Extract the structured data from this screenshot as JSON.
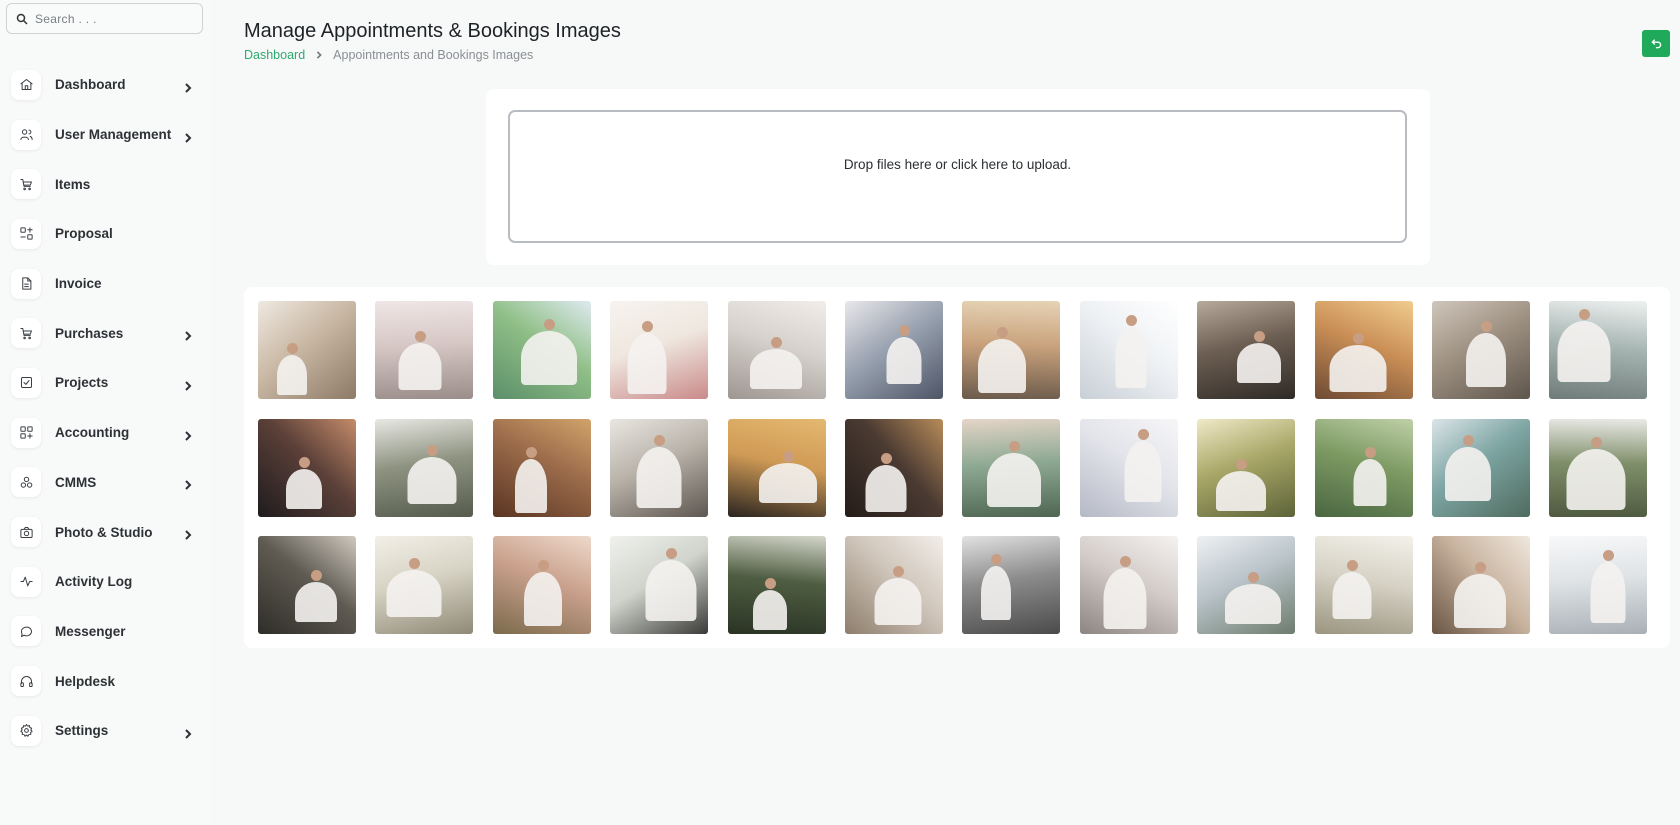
{
  "search": {
    "placeholder": "Search . . ."
  },
  "sidebar": {
    "items": [
      {
        "name": "dashboard",
        "label": "Dashboard",
        "icon": "home-icon",
        "chevron": true
      },
      {
        "name": "user-management",
        "label": "User Management",
        "icon": "users-icon",
        "chevron": true
      },
      {
        "name": "items",
        "label": "Items",
        "icon": "cart-icon",
        "chevron": false
      },
      {
        "name": "proposal",
        "label": "Proposal",
        "icon": "proposal-icon",
        "chevron": false
      },
      {
        "name": "invoice",
        "label": "Invoice",
        "icon": "file-icon",
        "chevron": false
      },
      {
        "name": "purchases",
        "label": "Purchases",
        "icon": "cart-icon",
        "chevron": true
      },
      {
        "name": "projects",
        "label": "Projects",
        "icon": "check-square-icon",
        "chevron": true
      },
      {
        "name": "accounting",
        "label": "Accounting",
        "icon": "grid-icon",
        "chevron": true
      },
      {
        "name": "cmms",
        "label": "CMMS",
        "icon": "cmms-icon",
        "chevron": true
      },
      {
        "name": "photo-studio",
        "label": "Photo & Studio",
        "icon": "camera-icon",
        "chevron": true
      },
      {
        "name": "activity-log",
        "label": "Activity Log",
        "icon": "activity-icon",
        "chevron": false
      },
      {
        "name": "messenger",
        "label": "Messenger",
        "icon": "chat-icon",
        "chevron": false
      },
      {
        "name": "helpdesk",
        "label": "Helpdesk",
        "icon": "headphones-icon",
        "chevron": false
      },
      {
        "name": "settings",
        "label": "Settings",
        "icon": "gear-icon",
        "chevron": true
      }
    ]
  },
  "header": {
    "title": "Manage Appointments & Bookings Images",
    "breadcrumb": {
      "home": "Dashboard",
      "current": "Appointments and Bookings Images"
    },
    "back_icon": "back-arrow-icon"
  },
  "upload": {
    "text": "Drop files here or click here to upload."
  },
  "gallery": {
    "images": [
      {
        "name": "bride-gown-back-lights",
        "colors": [
          "#c9b8a4",
          "#8d7a66",
          "#efe9e2"
        ]
      },
      {
        "name": "wedding-stage-decor",
        "colors": [
          "#d6c7c4",
          "#9a8d8a",
          "#efe6e6"
        ]
      },
      {
        "name": "beach-ceremony-arch",
        "colors": [
          "#8fbf86",
          "#5c8f6a",
          "#dfeaf0"
        ]
      },
      {
        "name": "bride-bouquet-hands",
        "colors": [
          "#efe7df",
          "#c98a8a",
          "#f7f3ef"
        ]
      },
      {
        "name": "couple-hands-rings",
        "colors": [
          "#d6d1cc",
          "#9e9690",
          "#f1ede9"
        ]
      },
      {
        "name": "couple-garden-standing",
        "colors": [
          "#9aa3b1",
          "#4d5566",
          "#e9e8ea"
        ]
      },
      {
        "name": "couple-bench-sunset",
        "colors": [
          "#c9a27c",
          "#6b5a4b",
          "#e6d3b6"
        ]
      },
      {
        "name": "bride-white-curtains",
        "colors": [
          "#eef1f4",
          "#c8cfd6",
          "#ffffff"
        ]
      },
      {
        "name": "couple-embrace-dark",
        "colors": [
          "#6c5e52",
          "#2f2a26",
          "#b7aa9c"
        ]
      },
      {
        "name": "couple-sunlight-kiss",
        "colors": [
          "#c98e55",
          "#6d4a34",
          "#f1cc8f"
        ]
      },
      {
        "name": "couple-stone-stairs",
        "colors": [
          "#9e9182",
          "#5e554b",
          "#cfc6bb"
        ]
      },
      {
        "name": "bride-gown-window",
        "colors": [
          "#a8b6b3",
          "#6e7b78",
          "#eef2f1"
        ]
      },
      {
        "name": "couple-night-street",
        "colors": [
          "#5b4038",
          "#1f1b1e",
          "#c48b6a"
        ]
      },
      {
        "name": "couple-seated-outdoors",
        "colors": [
          "#8f9482",
          "#555b4d",
          "#e8e8e3"
        ]
      },
      {
        "name": "cathedral-aisle",
        "colors": [
          "#9a6a4a",
          "#5a3522",
          "#d1a46a"
        ]
      },
      {
        "name": "couple-lake-dock",
        "colors": [
          "#b9b3aa",
          "#5e5650",
          "#e9e6e1"
        ]
      },
      {
        "name": "couple-silhouette",
        "colors": [
          "#cf9a55",
          "#2a2420",
          "#e4b870"
        ]
      },
      {
        "name": "couple-chandelier-room",
        "colors": [
          "#4a3a32",
          "#241c18",
          "#b88c5a"
        ]
      },
      {
        "name": "couple-closeup-smile",
        "colors": [
          "#8faa94",
          "#4e6652",
          "#e5d5c8"
        ]
      },
      {
        "name": "white-aisle-flowers",
        "colors": [
          "#e3e4ea",
          "#b5b9c6",
          "#f6f6f8"
        ]
      },
      {
        "name": "couple-field-sunlight",
        "colors": [
          "#a9a868",
          "#5d6339",
          "#f0e9c8"
        ]
      },
      {
        "name": "bride-blue-dress-field",
        "colors": [
          "#7d9a63",
          "#4a6641",
          "#bfd0a8"
        ]
      },
      {
        "name": "outdoor-guests-ceremony",
        "colors": [
          "#7da5a3",
          "#4f6b5e",
          "#dbe4e8"
        ]
      },
      {
        "name": "couple-greenery-portrait",
        "colors": [
          "#7f8f6a",
          "#4f5a40",
          "#eae9e6"
        ]
      },
      {
        "name": "bride-barn-interior",
        "colors": [
          "#5f5b52",
          "#2f2d29",
          "#cfc9bf"
        ]
      },
      {
        "name": "groom-bride-bouquet-closeup",
        "colors": [
          "#d7d3c4",
          "#8f8a77",
          "#f2efe7"
        ]
      },
      {
        "name": "pink-table-decor",
        "colors": [
          "#c9a08c",
          "#7b6a4b",
          "#eed9cb"
        ]
      },
      {
        "name": "couple-floral-wall",
        "colors": [
          "#d0d4cc",
          "#3a3a38",
          "#f0f1ed"
        ]
      },
      {
        "name": "couple-vintage-car",
        "colors": [
          "#4f5e42",
          "#2a3324",
          "#d4d6ca"
        ]
      },
      {
        "name": "long-dining-table",
        "colors": [
          "#cfc5ba",
          "#8e7e6c",
          "#f2eee9"
        ]
      },
      {
        "name": "bride-veil-studio",
        "colors": [
          "#8c8c8c",
          "#4b4b4b",
          "#e2e2e2"
        ]
      },
      {
        "name": "bride-lace-headpiece",
        "colors": [
          "#d3ccc9",
          "#8d8582",
          "#f5f2f1"
        ]
      },
      {
        "name": "bride-hydrangeas",
        "colors": [
          "#b9c3c9",
          "#6d7c6d",
          "#eef1f3"
        ]
      },
      {
        "name": "couple-table-picnic",
        "colors": [
          "#d6d2c5",
          "#9b9580",
          "#f3f1ea"
        ]
      },
      {
        "name": "reception-hall-windows",
        "colors": [
          "#c9b4a0",
          "#6b5544",
          "#efe7dd"
        ]
      },
      {
        "name": "bride-lying-white",
        "colors": [
          "#dfe3e6",
          "#a9b0b5",
          "#f7f8f9"
        ]
      }
    ]
  }
}
